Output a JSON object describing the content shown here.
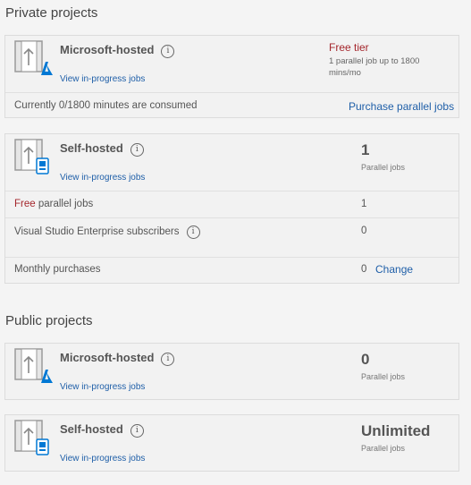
{
  "private": {
    "title": "Private projects",
    "microsoft": {
      "title": "Microsoft-hosted",
      "link": "View in-progress jobs",
      "tier": "Free tier",
      "tier_note": "1 parallel job up to 1800 mins/mo",
      "consumed": "Currently 0/1800 minutes are consumed",
      "purchase": "Purchase parallel jobs"
    },
    "self": {
      "title": "Self-hosted",
      "link": "View in-progress jobs",
      "value": "1",
      "value_label": "Parallel jobs",
      "free_word": "Free",
      "free_rest": " parallel jobs",
      "free_value": "1",
      "vs_label": "Visual Studio Enterprise subscribers",
      "vs_value": "0",
      "monthly_label": "Monthly purchases",
      "monthly_value": "0",
      "change": "Change"
    }
  },
  "public": {
    "title": "Public projects",
    "microsoft": {
      "title": "Microsoft-hosted",
      "link": "View in-progress jobs",
      "value": "0",
      "value_label": "Parallel jobs"
    },
    "self": {
      "title": "Self-hosted",
      "link": "View in-progress jobs",
      "value": "Unlimited",
      "value_label": "Parallel jobs"
    }
  },
  "icons": {
    "info": "info-icon",
    "agent": "build-agent-icon",
    "azure": "azure-logo-icon",
    "device": "device-icon"
  },
  "colors": {
    "link": "#1f5fa8",
    "free": "#a4262c",
    "azure": "#0078d4"
  }
}
